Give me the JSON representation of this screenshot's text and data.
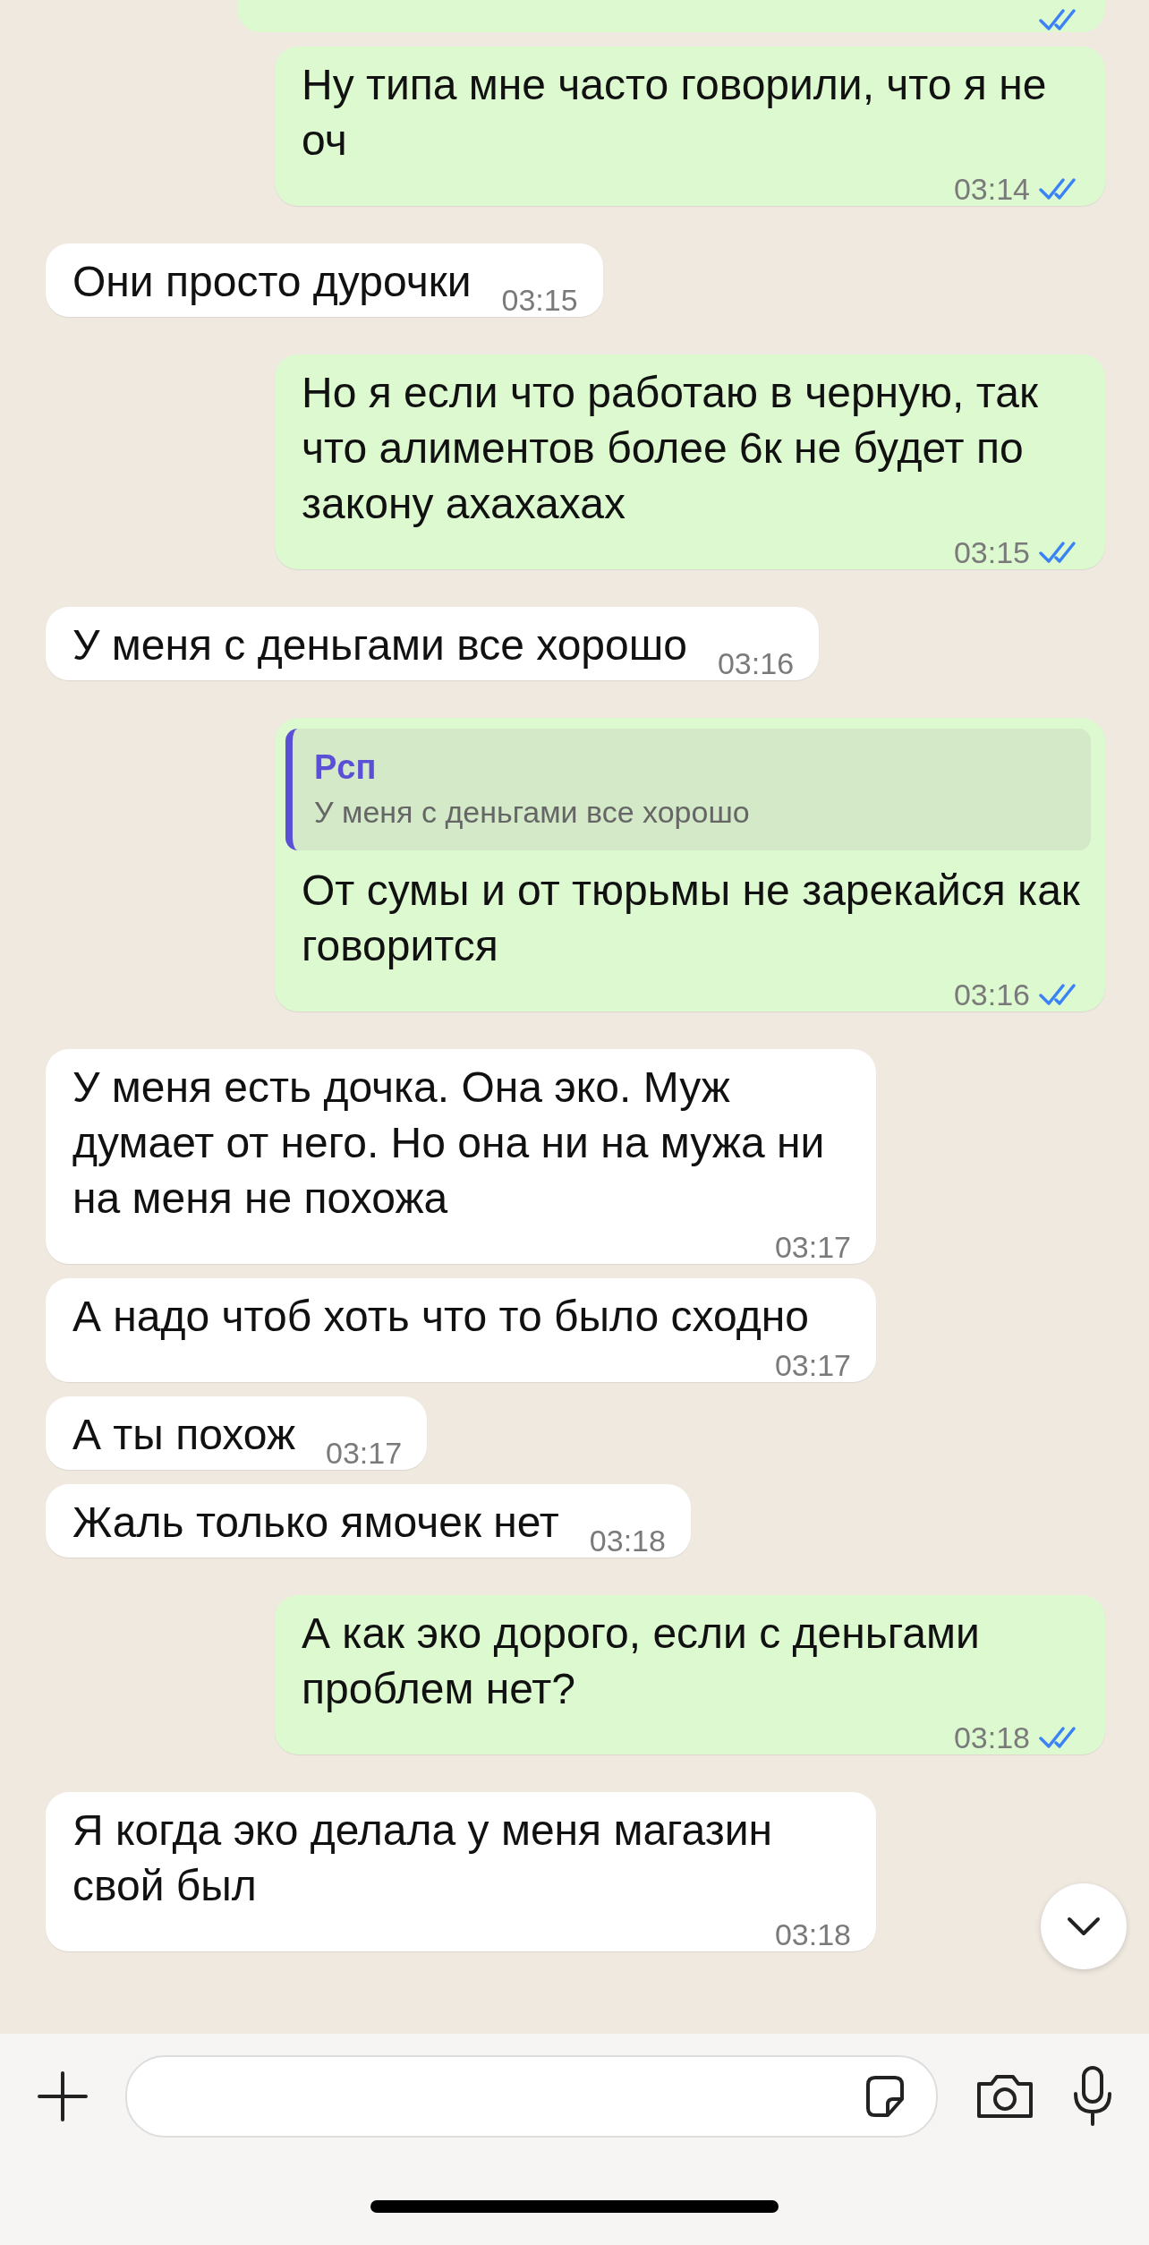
{
  "messages": [
    {
      "kind": "stub",
      "outgoing": true,
      "read": true
    },
    {
      "kind": "text",
      "outgoing": true,
      "text": "Ну типа мне часто говорили, что я не оч",
      "time": "03:14",
      "read": true
    },
    {
      "kind": "text",
      "outgoing": false,
      "text": "Они просто дурочки",
      "time": "03:15"
    },
    {
      "kind": "text",
      "outgoing": true,
      "text": "Но я если что работаю в черную, так что алиментов более 6к не будет по закону ахахахах",
      "time": "03:15",
      "read": true
    },
    {
      "kind": "text",
      "outgoing": false,
      "text": "У меня с деньгами все хорошо",
      "time": "03:16"
    },
    {
      "kind": "reply",
      "outgoing": true,
      "quote": {
        "author": "Рсп",
        "text": "У меня с деньгами все хорошо"
      },
      "text": "От сумы и от тюрьмы не зарекайся как говорится",
      "time": "03:16",
      "read": true
    },
    {
      "kind": "text",
      "outgoing": false,
      "text": "У меня есть дочка. Она эко. Муж думает от него. Но она ни на мужа ни на меня не похожа",
      "time": "03:17"
    },
    {
      "kind": "text",
      "outgoing": false,
      "text": "А надо чтоб хоть что то было сходно",
      "time": "03:17"
    },
    {
      "kind": "text",
      "outgoing": false,
      "text": "А ты похож",
      "time": "03:17"
    },
    {
      "kind": "text",
      "outgoing": false,
      "text": "Жаль только ямочек нет",
      "time": "03:18"
    },
    {
      "kind": "text",
      "outgoing": true,
      "text": "А как эко дорого, если с деньгами проблем нет?",
      "time": "03:18",
      "read": true
    },
    {
      "kind": "text",
      "outgoing": false,
      "text": "Я когда эко делала у меня магазин свой был",
      "time": "03:18"
    }
  ]
}
